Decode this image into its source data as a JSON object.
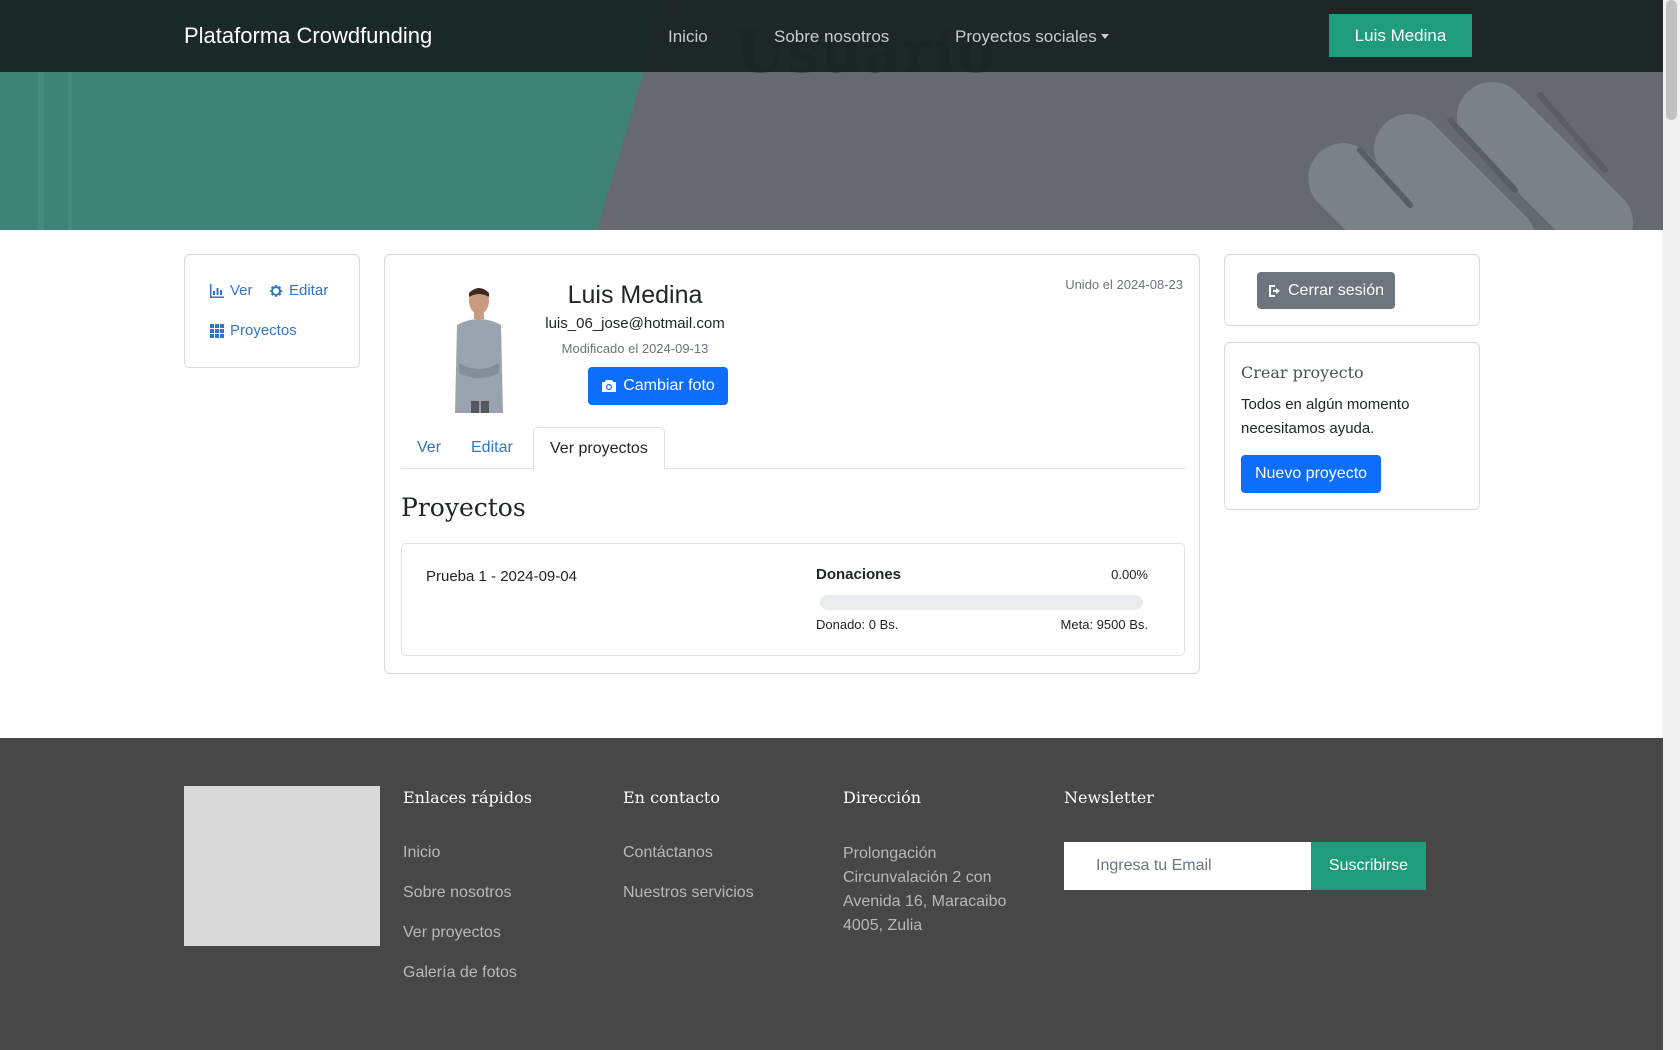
{
  "navbar": {
    "brand": "Plataforma Crowdfunding",
    "links": [
      "Inicio",
      "Sobre nosotros",
      "Proyectos sociales"
    ],
    "user_button": "Luis Medina"
  },
  "hero": {
    "title": "Usuario"
  },
  "sidebar": {
    "view_label": "Ver",
    "edit_label": "Editar",
    "projects_label": "Proyectos"
  },
  "profile": {
    "name": "Luis Medina",
    "email": "luis_06_jose@hotmail.com",
    "modified": "Modificado el 2024-09-13",
    "joined": "Unido el 2024-08-23",
    "change_photo": "Cambiar foto",
    "tabs": [
      "Ver",
      "Editar",
      "Ver proyectos"
    ],
    "active_tab": "Ver proyectos"
  },
  "projects": {
    "title": "Proyectos",
    "items": [
      {
        "name": "Prueba 1 - 2024-09-04",
        "donations_label": "Donaciones",
        "percent": "0.00%",
        "progress": 0,
        "donated": "Donado: 0 Bs.",
        "goal": "Meta: 9500 Bs."
      }
    ]
  },
  "session": {
    "logout": "Cerrar sesión"
  },
  "create": {
    "title": "Crear proyecto",
    "text": "Todos en algún momento necesitamos ayuda.",
    "button": "Nuevo proyecto"
  },
  "footer": {
    "quick_links_title": "Enlaces rápidos",
    "quick_links": [
      "Inicio",
      "Sobre nosotros",
      "Ver proyectos",
      "Galería de fotos"
    ],
    "contact_title": "En contacto",
    "contact_links": [
      "Contáctanos",
      "Nuestros servicios"
    ],
    "address_title": "Dirección",
    "address": "Prolongación Circunvalación 2 con Avenida 16, Maracaibo 4005, Zulia",
    "newsletter_title": "Newsletter",
    "email_placeholder": "Ingresa tu Email",
    "subscribe": "Suscribirse"
  },
  "colors": {
    "accent": "#1e9c7c",
    "primary": "#0d6efd",
    "secondary": "#6c757d",
    "footer_bg": "#474747"
  }
}
